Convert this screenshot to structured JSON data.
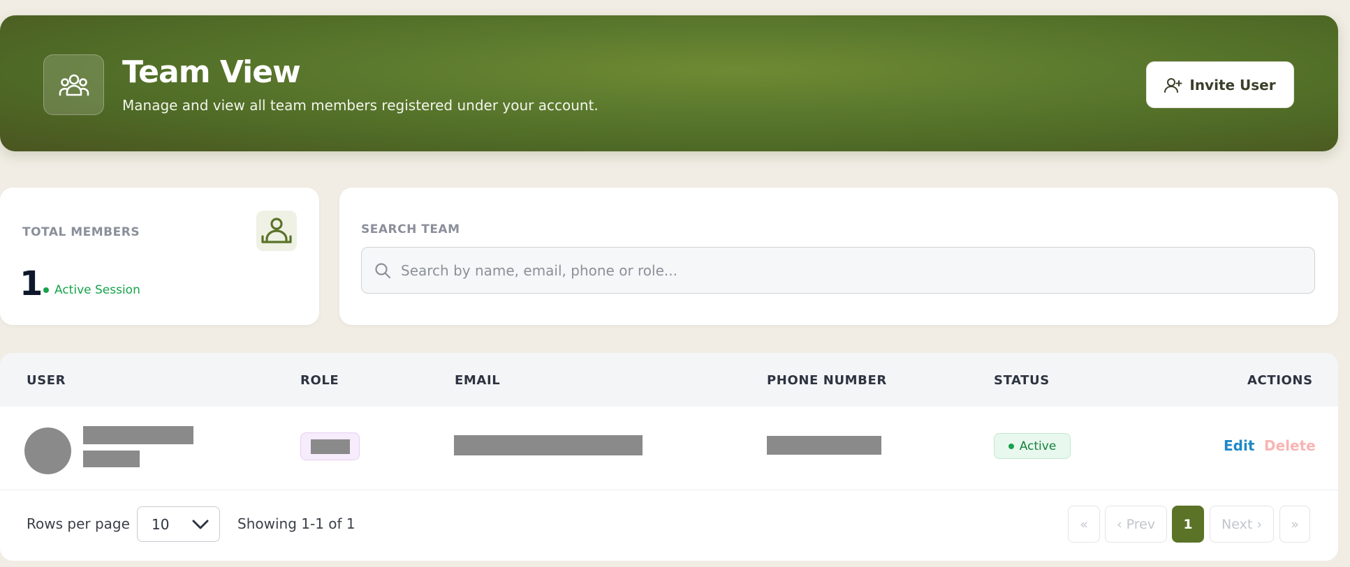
{
  "header": {
    "title": "Team View",
    "subtitle": "Manage and view all team members registered under your account.",
    "invite_label": "Invite User",
    "icon": "users-group-icon"
  },
  "stats": {
    "total_label": "TOTAL MEMBERS",
    "total_value": "1",
    "session_label": "Active Session",
    "icon": "user-card-icon"
  },
  "search": {
    "label": "SEARCH TEAM",
    "placeholder": "Search by name, email, phone or role...",
    "value": ""
  },
  "table": {
    "columns": [
      "USER",
      "ROLE",
      "EMAIL",
      "PHONE NUMBER",
      "STATUS",
      "ACTIONS"
    ],
    "rows": [
      {
        "user_name": "[redacted]",
        "user_sub": "[redacted]",
        "role": "[redacted]",
        "email": "[redacted]",
        "phone": "[redacted]",
        "status": "Active",
        "edit_label": "Edit",
        "delete_label": "Delete"
      }
    ]
  },
  "pagination": {
    "rows_per_page_label": "Rows per page",
    "rows_per_page_value": "10",
    "showing": "Showing 1-1 of 1",
    "first": "«",
    "prev": "‹ Prev",
    "current": "1",
    "next": "Next ›",
    "last": "»"
  },
  "colors": {
    "brand": "#5a7327",
    "status_active": "#16a34a",
    "edit": "#1e88c8",
    "delete": "#f8b4b4"
  }
}
